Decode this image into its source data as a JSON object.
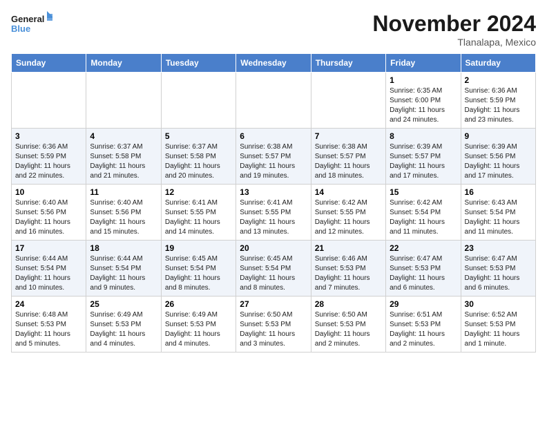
{
  "header": {
    "logo_line1": "General",
    "logo_line2": "Blue",
    "month_title": "November 2024",
    "location": "Tlanalapa, Mexico"
  },
  "weekdays": [
    "Sunday",
    "Monday",
    "Tuesday",
    "Wednesday",
    "Thursday",
    "Friday",
    "Saturday"
  ],
  "rows": [
    [
      {
        "day": "",
        "info": ""
      },
      {
        "day": "",
        "info": ""
      },
      {
        "day": "",
        "info": ""
      },
      {
        "day": "",
        "info": ""
      },
      {
        "day": "",
        "info": ""
      },
      {
        "day": "1",
        "info": "Sunrise: 6:35 AM\nSunset: 6:00 PM\nDaylight: 11 hours\nand 24 minutes."
      },
      {
        "day": "2",
        "info": "Sunrise: 6:36 AM\nSunset: 5:59 PM\nDaylight: 11 hours\nand 23 minutes."
      }
    ],
    [
      {
        "day": "3",
        "info": "Sunrise: 6:36 AM\nSunset: 5:59 PM\nDaylight: 11 hours\nand 22 minutes."
      },
      {
        "day": "4",
        "info": "Sunrise: 6:37 AM\nSunset: 5:58 PM\nDaylight: 11 hours\nand 21 minutes."
      },
      {
        "day": "5",
        "info": "Sunrise: 6:37 AM\nSunset: 5:58 PM\nDaylight: 11 hours\nand 20 minutes."
      },
      {
        "day": "6",
        "info": "Sunrise: 6:38 AM\nSunset: 5:57 PM\nDaylight: 11 hours\nand 19 minutes."
      },
      {
        "day": "7",
        "info": "Sunrise: 6:38 AM\nSunset: 5:57 PM\nDaylight: 11 hours\nand 18 minutes."
      },
      {
        "day": "8",
        "info": "Sunrise: 6:39 AM\nSunset: 5:57 PM\nDaylight: 11 hours\nand 17 minutes."
      },
      {
        "day": "9",
        "info": "Sunrise: 6:39 AM\nSunset: 5:56 PM\nDaylight: 11 hours\nand 17 minutes."
      }
    ],
    [
      {
        "day": "10",
        "info": "Sunrise: 6:40 AM\nSunset: 5:56 PM\nDaylight: 11 hours\nand 16 minutes."
      },
      {
        "day": "11",
        "info": "Sunrise: 6:40 AM\nSunset: 5:56 PM\nDaylight: 11 hours\nand 15 minutes."
      },
      {
        "day": "12",
        "info": "Sunrise: 6:41 AM\nSunset: 5:55 PM\nDaylight: 11 hours\nand 14 minutes."
      },
      {
        "day": "13",
        "info": "Sunrise: 6:41 AM\nSunset: 5:55 PM\nDaylight: 11 hours\nand 13 minutes."
      },
      {
        "day": "14",
        "info": "Sunrise: 6:42 AM\nSunset: 5:55 PM\nDaylight: 11 hours\nand 12 minutes."
      },
      {
        "day": "15",
        "info": "Sunrise: 6:42 AM\nSunset: 5:54 PM\nDaylight: 11 hours\nand 11 minutes."
      },
      {
        "day": "16",
        "info": "Sunrise: 6:43 AM\nSunset: 5:54 PM\nDaylight: 11 hours\nand 11 minutes."
      }
    ],
    [
      {
        "day": "17",
        "info": "Sunrise: 6:44 AM\nSunset: 5:54 PM\nDaylight: 11 hours\nand 10 minutes."
      },
      {
        "day": "18",
        "info": "Sunrise: 6:44 AM\nSunset: 5:54 PM\nDaylight: 11 hours\nand 9 minutes."
      },
      {
        "day": "19",
        "info": "Sunrise: 6:45 AM\nSunset: 5:54 PM\nDaylight: 11 hours\nand 8 minutes."
      },
      {
        "day": "20",
        "info": "Sunrise: 6:45 AM\nSunset: 5:54 PM\nDaylight: 11 hours\nand 8 minutes."
      },
      {
        "day": "21",
        "info": "Sunrise: 6:46 AM\nSunset: 5:53 PM\nDaylight: 11 hours\nand 7 minutes."
      },
      {
        "day": "22",
        "info": "Sunrise: 6:47 AM\nSunset: 5:53 PM\nDaylight: 11 hours\nand 6 minutes."
      },
      {
        "day": "23",
        "info": "Sunrise: 6:47 AM\nSunset: 5:53 PM\nDaylight: 11 hours\nand 6 minutes."
      }
    ],
    [
      {
        "day": "24",
        "info": "Sunrise: 6:48 AM\nSunset: 5:53 PM\nDaylight: 11 hours\nand 5 minutes."
      },
      {
        "day": "25",
        "info": "Sunrise: 6:49 AM\nSunset: 5:53 PM\nDaylight: 11 hours\nand 4 minutes."
      },
      {
        "day": "26",
        "info": "Sunrise: 6:49 AM\nSunset: 5:53 PM\nDaylight: 11 hours\nand 4 minutes."
      },
      {
        "day": "27",
        "info": "Sunrise: 6:50 AM\nSunset: 5:53 PM\nDaylight: 11 hours\nand 3 minutes."
      },
      {
        "day": "28",
        "info": "Sunrise: 6:50 AM\nSunset: 5:53 PM\nDaylight: 11 hours\nand 2 minutes."
      },
      {
        "day": "29",
        "info": "Sunrise: 6:51 AM\nSunset: 5:53 PM\nDaylight: 11 hours\nand 2 minutes."
      },
      {
        "day": "30",
        "info": "Sunrise: 6:52 AM\nSunset: 5:53 PM\nDaylight: 11 hours\nand 1 minute."
      }
    ]
  ]
}
